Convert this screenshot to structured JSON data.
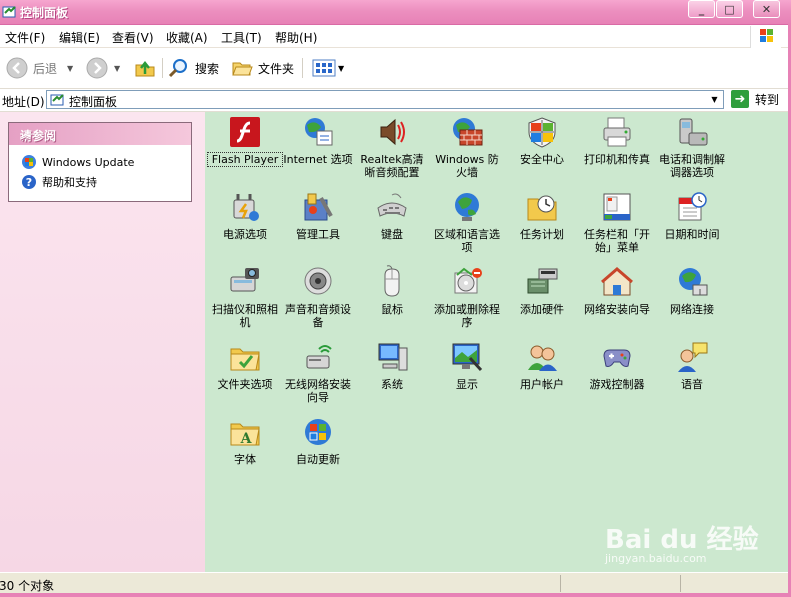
{
  "window": {
    "title": "控制面板",
    "controls": [
      "minimize",
      "maximize",
      "close"
    ]
  },
  "menu": [
    "文件(F)",
    "编辑(E)",
    "查看(V)",
    "收藏(A)",
    "工具(T)",
    "帮助(H)"
  ],
  "toolbar": {
    "back": "后退",
    "search": "搜索",
    "folders": "文件夹"
  },
  "address": {
    "label": "地址(D)",
    "value": "控制面板",
    "go": "转到"
  },
  "sidepanel": {
    "title": "请参阅",
    "links": [
      {
        "label": "Windows Update",
        "icon": "windows-update-icon"
      },
      {
        "label": "帮助和支持",
        "icon": "help-icon"
      }
    ]
  },
  "items": [
    {
      "label": "Flash Player",
      "icon": "flash-icon"
    },
    {
      "label": "Internet 选项",
      "icon": "internet-options-icon"
    },
    {
      "label": "Realtek高清晰音频配置",
      "icon": "realtek-audio-icon"
    },
    {
      "label": "Windows 防火墙",
      "icon": "firewall-icon"
    },
    {
      "label": "安全中心",
      "icon": "security-center-icon"
    },
    {
      "label": "打印机和传真",
      "icon": "printer-icon"
    },
    {
      "label": "电话和调制解调器选项",
      "icon": "phone-modem-icon"
    },
    {
      "label": "电源选项",
      "icon": "power-icon"
    },
    {
      "label": "管理工具",
      "icon": "admin-tools-icon"
    },
    {
      "label": "键盘",
      "icon": "keyboard-icon"
    },
    {
      "label": "区域和语言选项",
      "icon": "globe-icon"
    },
    {
      "label": "任务计划",
      "icon": "scheduled-tasks-icon"
    },
    {
      "label": "任务栏和「开始」菜单",
      "icon": "taskbar-icon"
    },
    {
      "label": "日期和时间",
      "icon": "datetime-icon"
    },
    {
      "label": "扫描仪和照相机",
      "icon": "scanner-camera-icon"
    },
    {
      "label": "声音和音频设备",
      "icon": "speaker-icon"
    },
    {
      "label": "鼠标",
      "icon": "mouse-icon"
    },
    {
      "label": "添加或删除程序",
      "icon": "add-remove-icon"
    },
    {
      "label": "添加硬件",
      "icon": "add-hardware-icon"
    },
    {
      "label": "网络安装向导",
      "icon": "network-setup-icon"
    },
    {
      "label": "网络连接",
      "icon": "network-connections-icon"
    },
    {
      "label": "文件夹选项",
      "icon": "folder-options-icon"
    },
    {
      "label": "无线网络安装向导",
      "icon": "wireless-icon"
    },
    {
      "label": "系统",
      "icon": "system-icon"
    },
    {
      "label": "显示",
      "icon": "display-icon"
    },
    {
      "label": "用户帐户",
      "icon": "user-accounts-icon"
    },
    {
      "label": "游戏控制器",
      "icon": "game-controller-icon"
    },
    {
      "label": "语音",
      "icon": "speech-icon"
    },
    {
      "label": "字体",
      "icon": "fonts-icon"
    },
    {
      "label": "自动更新",
      "icon": "auto-update-icon"
    }
  ],
  "status": {
    "text": "30 个对象"
  },
  "watermark": {
    "brand": "Bai du 经验",
    "url": "jingyan.baidu.com"
  },
  "colors": {
    "title": "#e782b6",
    "content_bg": "#cce8cf",
    "side_bg": "#fbe5ef"
  }
}
